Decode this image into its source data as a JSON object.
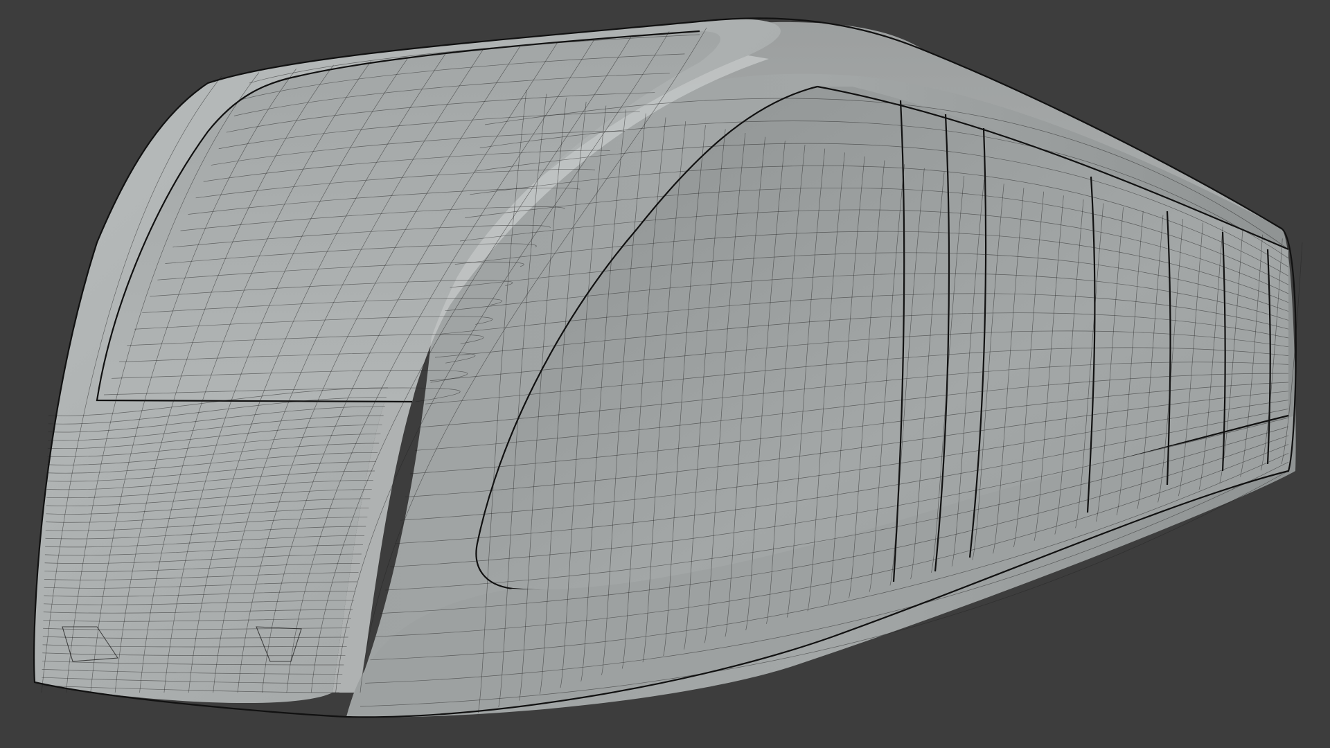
{
  "viewport": {
    "background_color": "#3d3d3d",
    "surface_color": "#a9adad",
    "surface_highlight": "#c7cbcb",
    "surface_shadow": "#8a8e8e",
    "wire_color": "#1c1c1c"
  },
  "model": {
    "icon": "train-mesh-icon",
    "display_mode": "wireframe-over-solid"
  }
}
